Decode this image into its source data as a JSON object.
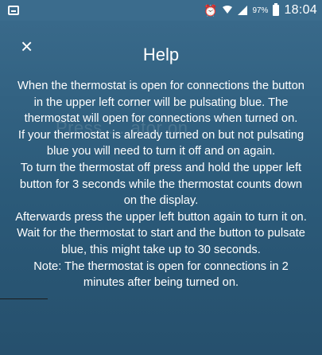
{
  "status_bar": {
    "battery": "97%",
    "time": "18:04"
  },
  "header": {
    "close_glyph": "×",
    "title": "Help"
  },
  "background_hint": "Press … ator on",
  "help": {
    "paragraphs": [
      "When the thermostat is open for connections the button in the upper left corner will be pulsating blue. The thermostat will open for connections when turned on.",
      "If your thermostat is already turned on but not pulsating blue you will need to turn it off and on again.",
      "To turn the thermostat off press and hold the upper left button for 3 seconds while the thermostat counts down on the display.",
      "Afterwards press the upper left button again to turn it on. Wait for the thermostat to start and the button to pulsate blue, this might take up to 30 seconds.",
      "Note: The thermostat is open for connections in 2 minutes after being turned on."
    ]
  }
}
